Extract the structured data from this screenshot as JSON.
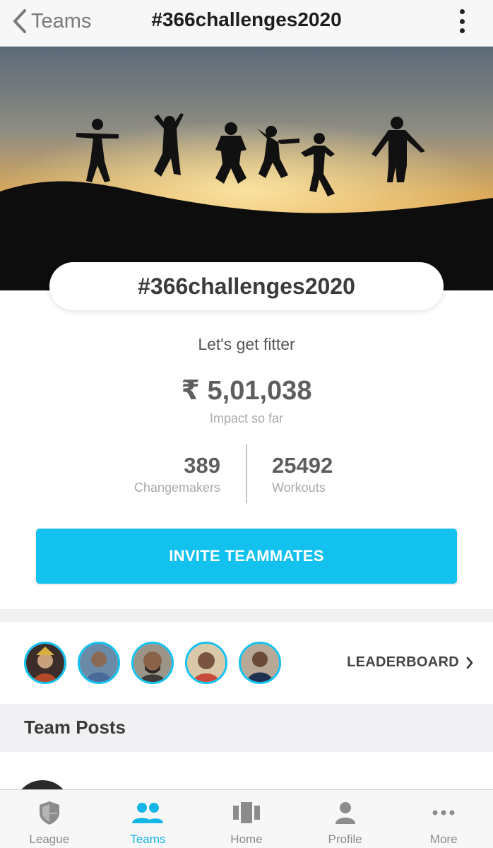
{
  "nav": {
    "back_label": "Teams",
    "title": "#366challenges2020"
  },
  "team": {
    "name": "#366challenges2020",
    "tagline": "Let's get fitter",
    "impact_value": "₹ 5,01,038",
    "impact_label": "Impact so far",
    "stats": [
      {
        "value": "389",
        "label": "Changemakers"
      },
      {
        "value": "25492",
        "label": "Workouts"
      }
    ]
  },
  "invite_button": "INVITE TEAMMATES",
  "members": {
    "leaderboard_label": "LEADERBOARD"
  },
  "posts": {
    "heading": "Team Posts"
  },
  "tabbar": {
    "items": [
      {
        "label": "League",
        "icon": "shield-icon",
        "active": false
      },
      {
        "label": "Teams",
        "icon": "people-icon",
        "active": true
      },
      {
        "label": "Home",
        "icon": "home-cards-icon",
        "active": false
      },
      {
        "label": "Profile",
        "icon": "person-icon",
        "active": false
      },
      {
        "label": "More",
        "icon": "more-dots-icon",
        "active": false
      }
    ]
  },
  "colors": {
    "accent": "#13c1ef",
    "tab_active": "#13b4e6"
  }
}
